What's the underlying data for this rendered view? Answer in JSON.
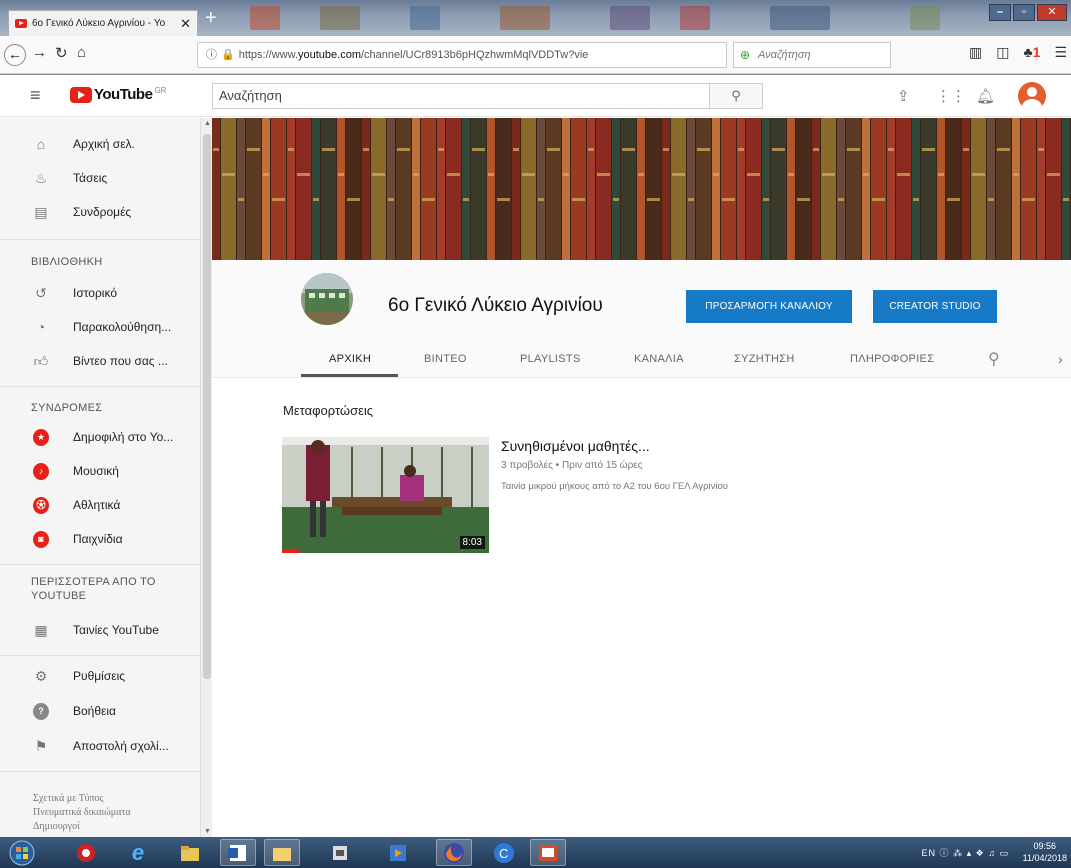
{
  "browser": {
    "tab_title": "6ο Γενικό Λύκειο Αγρινίου - Yo",
    "new_tab": "+",
    "url_prefix": "https://www.",
    "url_host": "youtube.com",
    "url_rest": "/channel/UCr8913b6pHQzhwmMqlVDDTw?vie",
    "search_placeholder": "Αναζήτηση",
    "notif_count": "1"
  },
  "youtube": {
    "logo": "YouTube",
    "region": "GR",
    "search_placeholder": "Αναζήτηση",
    "sidebar": {
      "main": [
        {
          "label": "Αρχική σελ.",
          "icon": "home-icon"
        },
        {
          "label": "Τάσεις",
          "icon": "flame-icon"
        },
        {
          "label": "Συνδρομές",
          "icon": "subscriptions-icon"
        }
      ],
      "library_header": "ΒΙΒΛΙΟΘΗΚΗ",
      "library": [
        {
          "label": "Ιστορικό",
          "icon": "history-icon"
        },
        {
          "label": "Παρακολούθηση...",
          "icon": "clock-icon"
        },
        {
          "label": "Βίντεο που σας ...",
          "icon": "thumbs-up-icon"
        }
      ],
      "subs_header": "ΣΥΝΔΡΟΜΕΣ",
      "subs": [
        {
          "label": "Δημοφιλή στο Yo...",
          "icon": "popular-icon",
          "color": "#e62117"
        },
        {
          "label": "Μουσική",
          "icon": "music-icon",
          "color": "#e62117"
        },
        {
          "label": "Αθλητικά",
          "icon": "sports-icon",
          "color": "#e62117"
        },
        {
          "label": "Παιχνίδια",
          "icon": "gaming-icon",
          "color": "#e62117"
        }
      ],
      "more_header_1": "ΠΕΡΙΣΣΟΤΕΡΑ ΑΠΟ ΤΟ",
      "more_header_2": "YOUTUBE",
      "more": [
        {
          "label": "Ταινίες YouTube",
          "icon": "film-icon"
        }
      ],
      "bottom": [
        {
          "label": "Ρυθμίσεις",
          "icon": "gear-icon"
        },
        {
          "label": "Βοήθεια",
          "icon": "help-icon"
        },
        {
          "label": "Αποστολή σχολί...",
          "icon": "feedback-icon"
        }
      ],
      "footer_1": "Σχετικά με  Τύπος",
      "footer_2": "Πνευματικά δικαιώματα",
      "footer_3": "Δημιουργοί"
    },
    "channel": {
      "name": "6ο Γενικό Λύκειο Αγρινίου",
      "customize_btn": "ΠΡΟΣΑΡΜΟΓΗ ΚΑΝΑΛΙΟΥ",
      "studio_btn": "CREATOR STUDIO",
      "tabs": [
        "ΑΡΧΙΚΗ",
        "ΒΙΝΤΕΟ",
        "PLAYLISTS",
        "ΚΑΝΑΛΙΑ",
        "ΣΥΖΗΤΗΣΗ",
        "ΠΛΗΡΟΦΟΡΙΕΣ"
      ],
      "accent": "#167ac6"
    },
    "uploads": {
      "title": "Μεταφορτώσεις",
      "video": {
        "title": "Συνηθισμένοι μαθητές...",
        "meta": "3 προβολές • Πριν από 15 ώρες",
        "description": "Ταινία μικρού μήκους από το Α2 του 6ου ΓΕΛ Αγρινίου",
        "duration": "8:03"
      }
    }
  },
  "taskbar": {
    "lang": "EN",
    "time": "09:56",
    "date": "11/04/2018"
  }
}
